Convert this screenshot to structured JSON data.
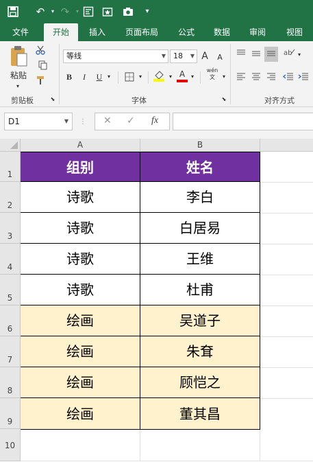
{
  "quick_access": {
    "icons": [
      "save-icon",
      "undo-icon",
      "redo-icon",
      "screenshot-tool-icon",
      "star-icon",
      "camera-icon",
      "customize-icon"
    ]
  },
  "tabs": [
    {
      "label": "文件",
      "active": false
    },
    {
      "label": "开始",
      "active": true
    },
    {
      "label": "插入",
      "active": false
    },
    {
      "label": "页面布局",
      "active": false
    },
    {
      "label": "公式",
      "active": false
    },
    {
      "label": "数据",
      "active": false
    },
    {
      "label": "审阅",
      "active": false
    },
    {
      "label": "视图",
      "active": false
    }
  ],
  "ribbon": {
    "paste_label": "粘贴",
    "clipboard_label": "剪贴板",
    "font_name": "等线",
    "font_size": "18",
    "font_group_label": "字体",
    "align_group_label": "对齐方式",
    "bold": "B",
    "italic": "I",
    "underline": "U",
    "grow_font": "A",
    "shrink_font": "A",
    "font_color_letter": "A",
    "phonetic": "wén"
  },
  "formula_bar": {
    "name_box": "D1",
    "cancel": "✕",
    "enter": "✓",
    "fx": "fx",
    "value": ""
  },
  "grid": {
    "columns": [
      "A",
      "B"
    ],
    "rows": [
      "1",
      "2",
      "3",
      "4",
      "5",
      "6",
      "7",
      "8",
      "9",
      "10"
    ],
    "header": {
      "col_a": "组别",
      "col_b": "姓名"
    },
    "data": [
      {
        "group": "诗歌",
        "name": "李白"
      },
      {
        "group": "诗歌",
        "name": "白居易"
      },
      {
        "group": "诗歌",
        "name": "王维"
      },
      {
        "group": "诗歌",
        "name": "杜甫"
      },
      {
        "group": "绘画",
        "name": "吴道子"
      },
      {
        "group": "绘画",
        "name": "朱耷"
      },
      {
        "group": "绘画",
        "name": "顾恺之"
      },
      {
        "group": "绘画",
        "name": "董其昌"
      }
    ]
  },
  "colors": {
    "accent": "#217346",
    "header_fill": "#7030a0",
    "painting_fill": "#fff2cc"
  }
}
